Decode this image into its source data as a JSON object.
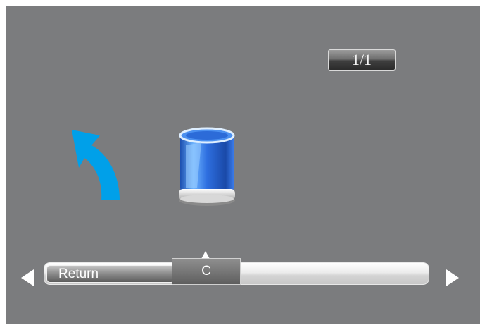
{
  "page_indicator": {
    "text": "1/1"
  },
  "icons": {
    "return": "return-arrow-icon",
    "drive": "drive-icon",
    "prev": "triangle-left-icon",
    "next": "triangle-right-icon"
  },
  "nav": {
    "items": [
      "Return",
      "C"
    ],
    "selected": "C"
  },
  "colors": {
    "background": "#7b7c7e",
    "accent": "#00a0e9"
  }
}
